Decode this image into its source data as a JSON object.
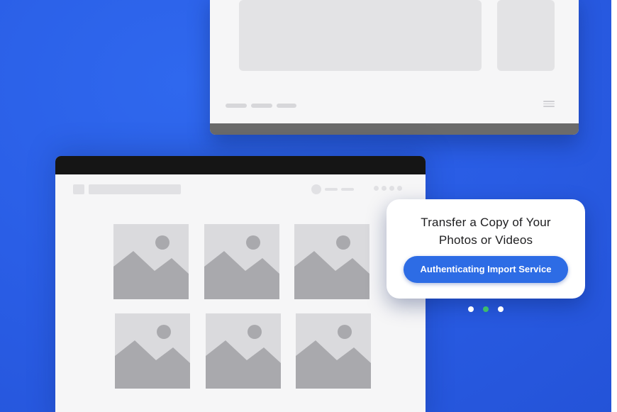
{
  "card": {
    "title_line1": "Transfer a Copy of Your",
    "title_line2": "Photos or Videos",
    "status_label": "Authenticating Import Service"
  },
  "pager": {
    "count": 3,
    "active_index": 1,
    "active_color": "#3dbb6b",
    "inactive_color": "#ffffff"
  },
  "colors": {
    "background": "#2a5ee6",
    "button": "#2d6ce5"
  },
  "icons": {
    "thumbnail": "image-placeholder-icon",
    "menu": "hamburger-menu-icon"
  }
}
